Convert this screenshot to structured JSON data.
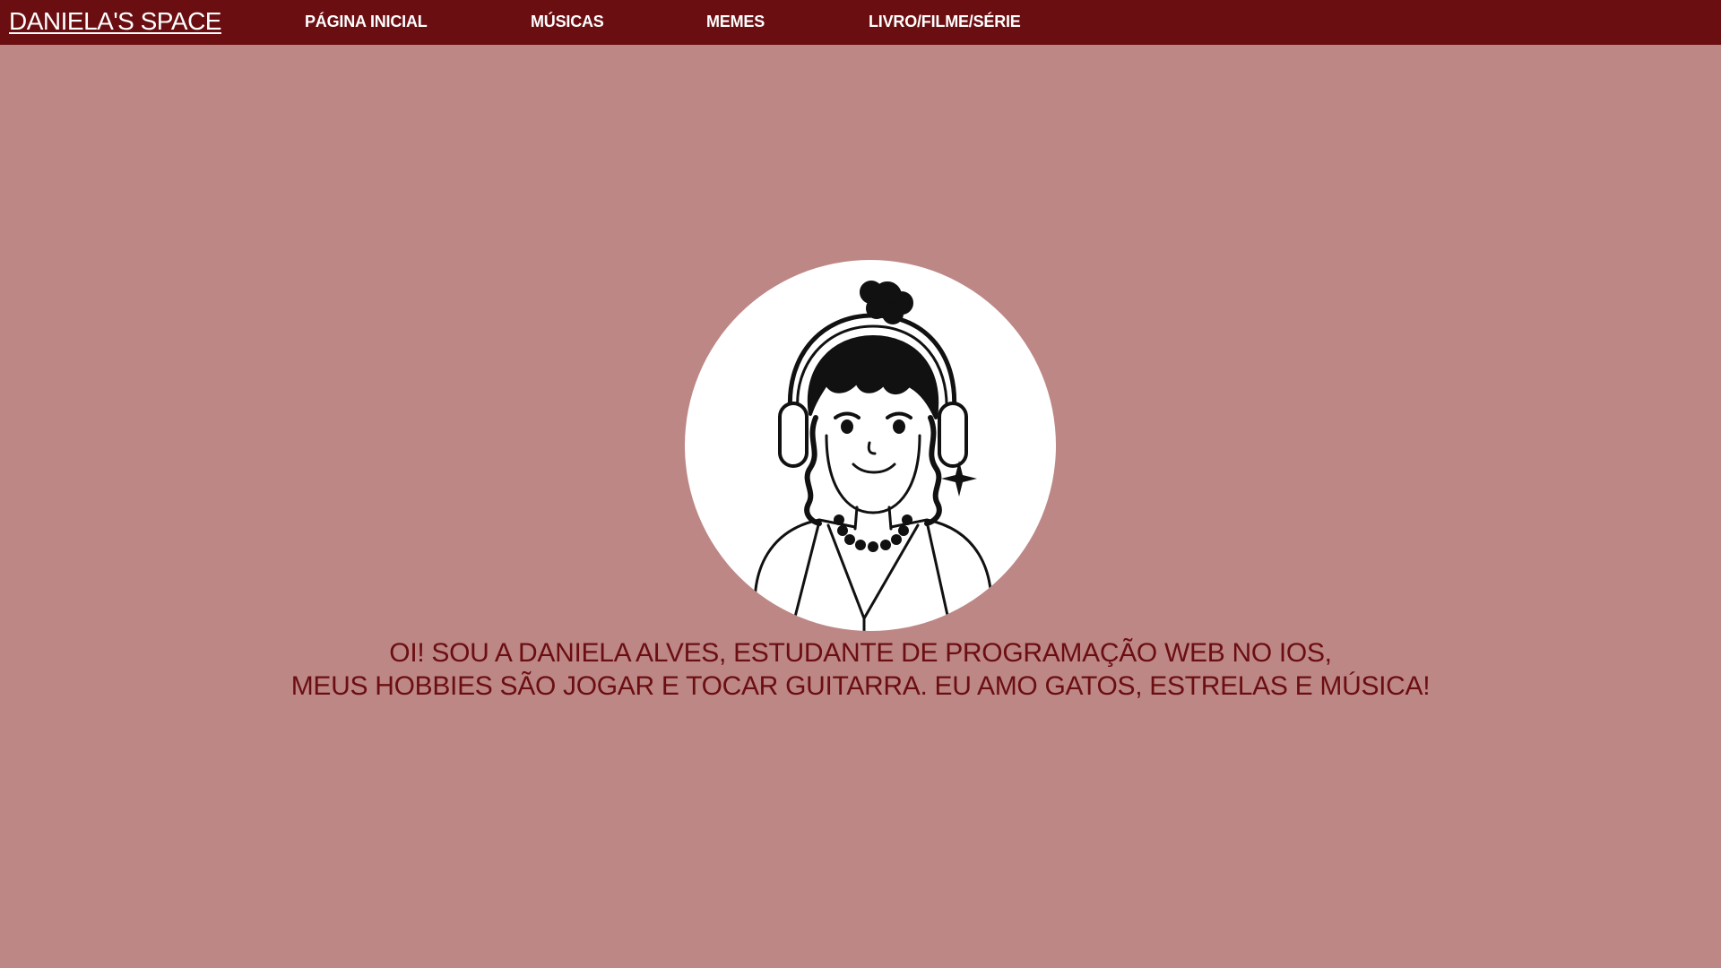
{
  "header": {
    "brand": "DANIELA'S SPACE",
    "nav": [
      {
        "label": "PÁGINA INICIAL"
      },
      {
        "label": "MÚSICAS"
      },
      {
        "label": "MEMES"
      },
      {
        "label": "LIVRO/FILME/SÉRIE"
      }
    ]
  },
  "main": {
    "avatar_icon": "girl-with-headphones-illustration",
    "intro_lines": [
      "OI! SOU A DANIELA ALVES, ESTUDANTE DE PROGRAMAÇÃO WEB NO IOS,",
      "MEUS HOBBIES SÃO JOGAR E TOCAR GUITARRA. EU AMO GATOS, ESTRELAS E MÚSICA!"
    ]
  },
  "colors": {
    "background": "#bd8786",
    "navbar": "#6b0e11",
    "nav_text": "#ffffff",
    "intro_text": "#6b0e11"
  }
}
